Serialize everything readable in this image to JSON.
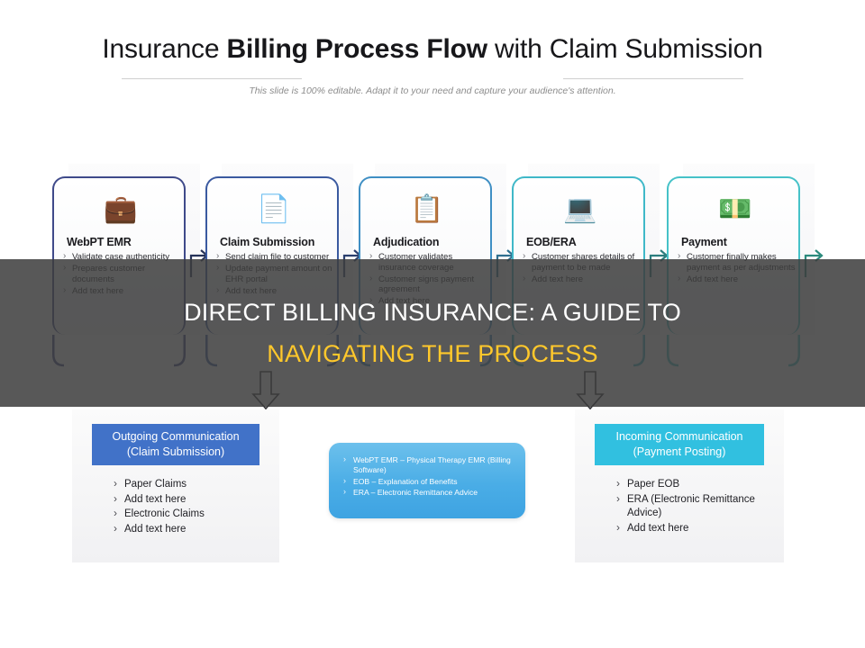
{
  "header": {
    "title_part1": "Insurance ",
    "title_part2": "Billing Process Flow",
    "title_part3": " with Claim Submission",
    "subtitle": "This slide is 100% editable. Adapt it to your need and capture your audience's attention."
  },
  "overlay": {
    "line1": "DIRECT BILLING INSURANCE: A GUIDE TO",
    "line2": "NAVIGATING THE PROCESS",
    "scrim_color": "#3c3c3c",
    "line1_color": "#ffffff",
    "line2_color": "#ffc82b"
  },
  "process": {
    "steps": [
      {
        "title": "WebPT EMR",
        "icon": "briefcase-search-icon",
        "icon_glyph": "💼",
        "border_color": "#3f4a8a",
        "bullets": [
          "Validate case authenticity",
          "Prepares customer documents",
          "Add text here"
        ]
      },
      {
        "title": "Claim Submission",
        "icon": "document-money-icon",
        "icon_glyph": "📄",
        "border_color": "#3b5aa0",
        "bullets": [
          "Send claim file to customer",
          "Update payment amount on EHR portal",
          "Add text here"
        ]
      },
      {
        "title": "Adjudication",
        "icon": "clipboard-shield-icon",
        "icon_glyph": "📋",
        "border_color": "#3f8fc4",
        "bullets": [
          "Customer validates insurance coverage",
          "Customer signs payment agreement",
          "Add text here"
        ]
      },
      {
        "title": "EOB/ERA",
        "icon": "bill-laptop-icon",
        "icon_glyph": "💻",
        "border_color": "#3fb8c8",
        "bullets": [
          "Customer shares details of payment to be made",
          "Add text here"
        ]
      },
      {
        "title": "Payment",
        "icon": "hand-cash-icon",
        "icon_glyph": "💵",
        "border_color": "#46c2c8",
        "bullets": [
          "Customer finally makes payment as per adjustments",
          "Add text here"
        ]
      }
    ],
    "connector_colors": [
      "#263258",
      "#2a3f6e",
      "#2f6f8f",
      "#2b7d7d",
      "#2a8a7c"
    ]
  },
  "panels": {
    "outgoing": {
      "head_line1": "Outgoing Communication",
      "head_line2": "(Claim Submission)",
      "head_color": "#4172c8",
      "bullets": [
        "Paper Claims",
        "Add text here",
        "Electronic Claims",
        "Add text here"
      ]
    },
    "center": {
      "bullets": [
        "WebPT EMR – Physical Therapy EMR (Billing Software)",
        "EOB – Explanation of Benefits",
        "ERA – Electronic Remittance Advice"
      ],
      "color": "#4aade6"
    },
    "incoming": {
      "head_line1": "Incoming Communication",
      "head_line2": "(Payment Posting)",
      "head_color": "#31c0e0",
      "bullets": [
        "Paper EOB",
        "ERA (Electronic Remittance Advice)",
        "Add text here"
      ]
    }
  }
}
